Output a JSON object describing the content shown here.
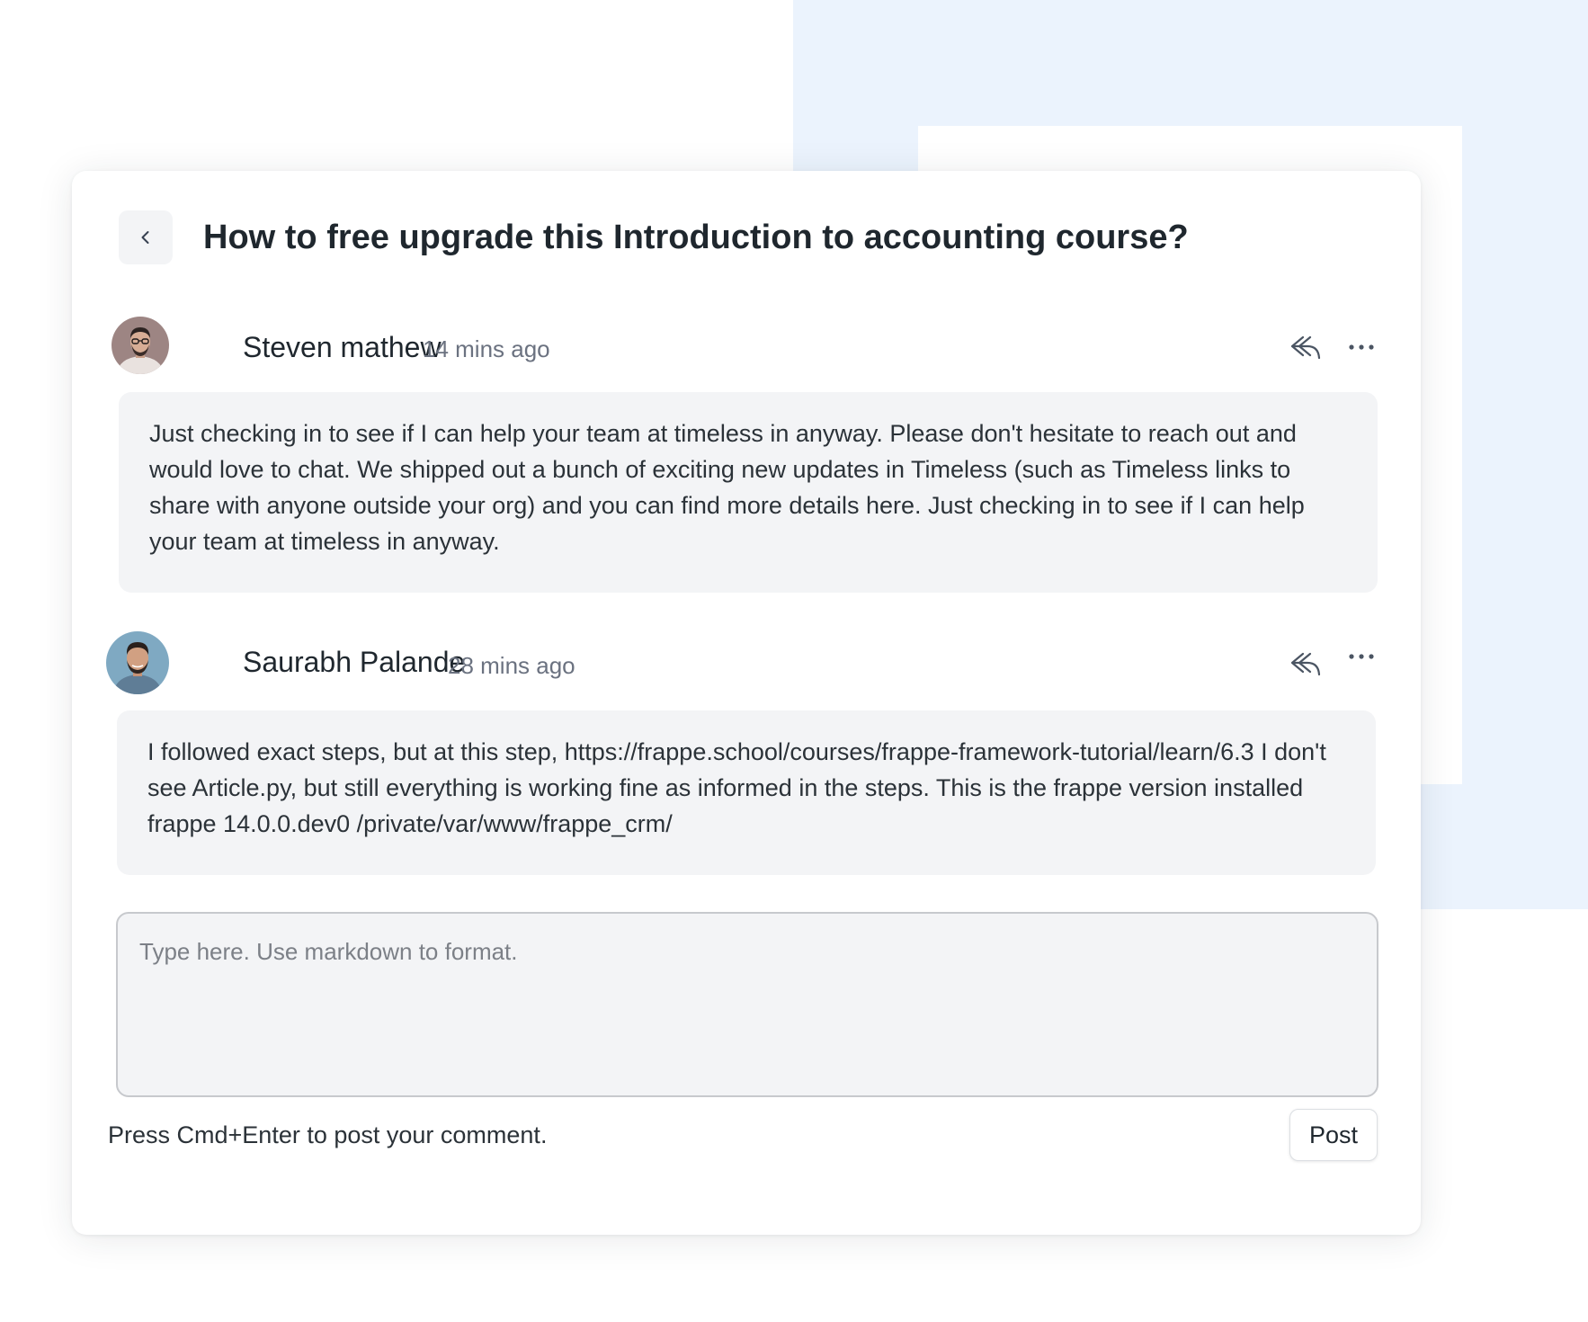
{
  "page": {
    "title": "How to free upgrade this Introduction to accounting course?",
    "back_icon": "chevron-left-icon"
  },
  "comments": [
    {
      "author": "Steven mathew",
      "time": "14 mins ago",
      "body": "Just checking in to see if I can help your team at timeless in anyway. Please don't hesitate to reach out  and would love to chat. We shipped out a bunch of exciting new updates in Timeless (such as Timeless links to share with anyone outside your org) and you can find more details here. Just checking in to see if I can help your team at timeless in anyway.",
      "reply_icon": "reply-icon",
      "more_icon": "more-horizontal-icon"
    },
    {
      "author": "Saurabh Palande",
      "time": "28 mins ago",
      "body": "I followed exact steps, but at this step, https://frappe.school/courses/frappe-framework-tutorial/learn/6.3 I don't see Article.py, but still everything is working fine as informed in the steps. This is the frappe version installed frappe 14.0.0.dev0 /private/var/www/frappe_crm/",
      "reply_icon": "reply-icon",
      "more_icon": "more-horizontal-icon"
    }
  ],
  "composer": {
    "placeholder": "Type here. Use markdown to format.",
    "value": "",
    "hint": "Press Cmd+Enter to post your comment.",
    "post_label": "Post"
  },
  "colors": {
    "background_accent": "#ebf3fd",
    "card": "#ffffff",
    "bubble": "#f3f4f6",
    "text": "#1f272e",
    "muted": "#6b7280"
  }
}
